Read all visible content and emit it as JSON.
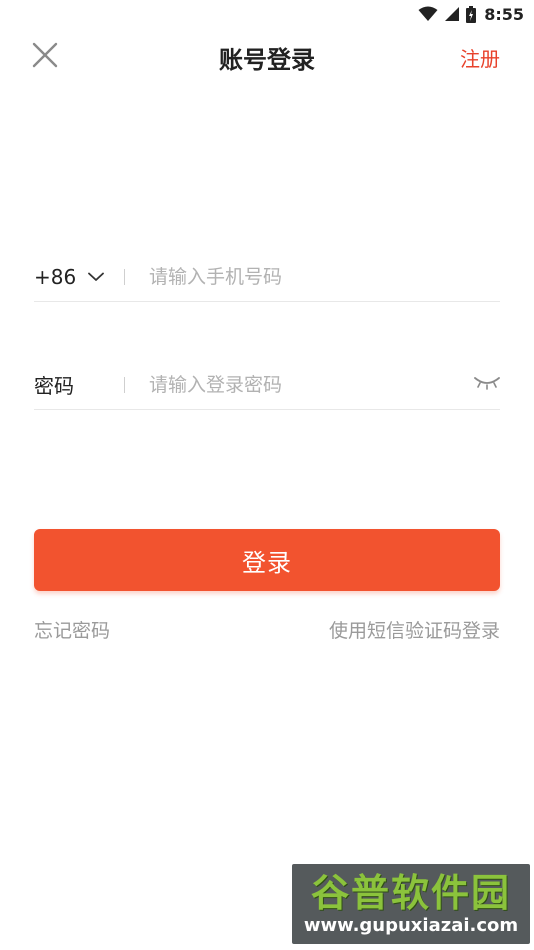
{
  "status_bar": {
    "time": "8:55"
  },
  "header": {
    "title": "账号登录",
    "register_label": "注册"
  },
  "phone_row": {
    "country_code": "+86",
    "placeholder": "请输入手机号码"
  },
  "password_row": {
    "label": "密码",
    "placeholder": "请输入登录密码"
  },
  "login_button": {
    "label": "登录"
  },
  "links": {
    "forgot_password": "忘记密码",
    "sms_login": "使用短信验证码登录"
  },
  "watermark": {
    "title": "谷普软件园",
    "url": "www.gupuxiazai.com"
  },
  "colors": {
    "accent": "#f2532f",
    "register_text": "#e8422b",
    "secondary_text": "#9a9a9a",
    "placeholder": "#b2b2b2"
  }
}
